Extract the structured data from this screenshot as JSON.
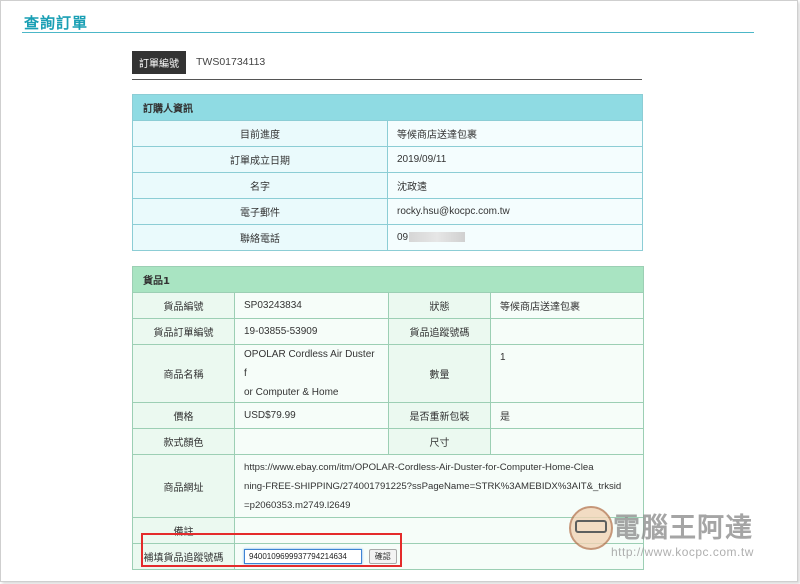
{
  "page_title": "查詢訂單",
  "order": {
    "label": "訂單編號",
    "value": "TWS01734113"
  },
  "buyer": {
    "header": "訂購人資訊",
    "rows": [
      {
        "label": "目前進度",
        "value": "等候商店送達包裹"
      },
      {
        "label": "訂單成立日期",
        "value": "2019/09/11"
      },
      {
        "label": "名字",
        "value": "沈政遠"
      },
      {
        "label": "電子郵件",
        "value": "rocky.hsu@kocpc.com.tw"
      },
      {
        "label": "聯絡電話",
        "value": "09"
      }
    ]
  },
  "goods": {
    "header": "貨品1",
    "item_no_label": "貨品編號",
    "item_no": "SP03243834",
    "status_label": "狀態",
    "status": "等候商店送達包裹",
    "item_order_no_label": "貨品訂單編號",
    "item_order_no": "19-03855-53909",
    "tracking_label": "貨品追蹤號碼",
    "tracking": "",
    "name_label": "商品名稱",
    "name_line1": "OPOLAR Cordless Air Duster f",
    "name_line2": "or Computer & Home",
    "qty_label": "數量",
    "qty": "1",
    "price_label": "價格",
    "price": "USD$79.99",
    "repack_label": "是否重新包裝",
    "repack": "是",
    "color_label": "款式顏色",
    "color": "",
    "size_label": "尺寸",
    "size": "",
    "url_label": "商品網址",
    "url_line1": "https://www.ebay.com/itm/OPOLAR-Cordless-Air-Duster-for-Computer-Home-Clea",
    "url_line2": "ning-FREE-SHIPPING/274001791225?ssPageName=STRK%3AMEBIDX%3AIT&_trksid",
    "url_line3": "=p2060353.m2749.l2649",
    "note_label": "備註",
    "note": "",
    "fill_tracking_label": "補填貨品追蹤號碼",
    "fill_tracking_value": "9400109699937794214634",
    "confirm_label": "確認"
  },
  "watermark": {
    "title": "電腦王阿達",
    "url": "http://www.kocpc.com.tw"
  },
  "colors": {
    "accent": "#1a9fb4",
    "buyer_header": "#8fdbe3",
    "goods_header": "#a9e4c2",
    "highlight": "#e42b2b"
  }
}
